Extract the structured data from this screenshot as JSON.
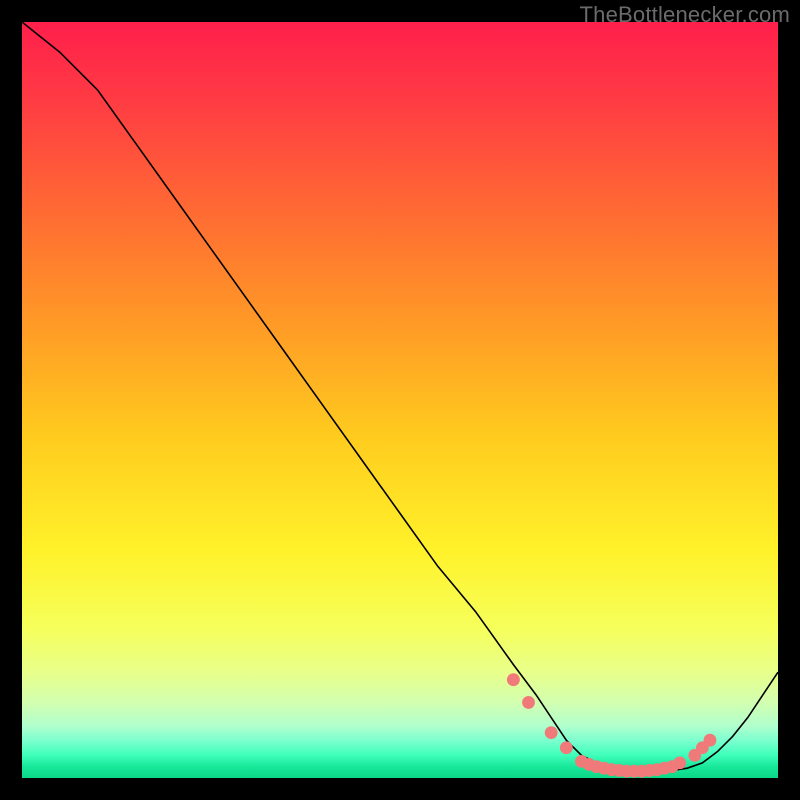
{
  "watermark": "TheBottlenecker.com",
  "chart_data": {
    "type": "line",
    "title": "",
    "xlabel": "",
    "ylabel": "",
    "xlim": [
      0,
      100
    ],
    "ylim": [
      0,
      100
    ],
    "series": [
      {
        "name": "curve",
        "x": [
          0,
          5,
          10,
          15,
          20,
          25,
          30,
          35,
          40,
          45,
          50,
          55,
          60,
          65,
          68,
          70,
          72,
          74,
          76,
          78,
          80,
          82,
          84,
          86,
          88,
          90,
          92,
          94,
          96,
          98,
          100
        ],
        "y": [
          100,
          96,
          91,
          84,
          77,
          70,
          63,
          56,
          49,
          42,
          35,
          28,
          22,
          15,
          11,
          8,
          5,
          3,
          2,
          1.2,
          1,
          0.9,
          0.9,
          1.0,
          1.3,
          2.0,
          3.5,
          5.5,
          8,
          11,
          14
        ]
      }
    ],
    "markers": {
      "name": "dots",
      "x": [
        65,
        67,
        70,
        72,
        74,
        75,
        76,
        77,
        78,
        79,
        80,
        81,
        82,
        83,
        84,
        85,
        86,
        87,
        89,
        90,
        91
      ],
      "y": [
        13,
        10,
        6,
        4,
        2.2,
        1.8,
        1.5,
        1.3,
        1.1,
        1.0,
        0.9,
        0.9,
        0.9,
        1.0,
        1.1,
        1.3,
        1.5,
        2.0,
        3.0,
        4.0,
        5.0
      ]
    },
    "background_gradient": {
      "type": "vertical",
      "stops": [
        {
          "offset": 0.0,
          "color": "#ff1f4b"
        },
        {
          "offset": 0.1,
          "color": "#ff3a44"
        },
        {
          "offset": 0.25,
          "color": "#ff6a33"
        },
        {
          "offset": 0.4,
          "color": "#ff9a26"
        },
        {
          "offset": 0.55,
          "color": "#ffcc1e"
        },
        {
          "offset": 0.7,
          "color": "#fff22a"
        },
        {
          "offset": 0.8,
          "color": "#f6ff5a"
        },
        {
          "offset": 0.86,
          "color": "#e8ff8a"
        },
        {
          "offset": 0.9,
          "color": "#d2ffb0"
        },
        {
          "offset": 0.93,
          "color": "#b2ffcc"
        },
        {
          "offset": 0.95,
          "color": "#7dffcf"
        },
        {
          "offset": 0.97,
          "color": "#3effba"
        },
        {
          "offset": 0.985,
          "color": "#18e89a"
        },
        {
          "offset": 1.0,
          "color": "#0bd886"
        }
      ]
    },
    "marker_color": "#f07a7a",
    "line_color": "#000000"
  }
}
